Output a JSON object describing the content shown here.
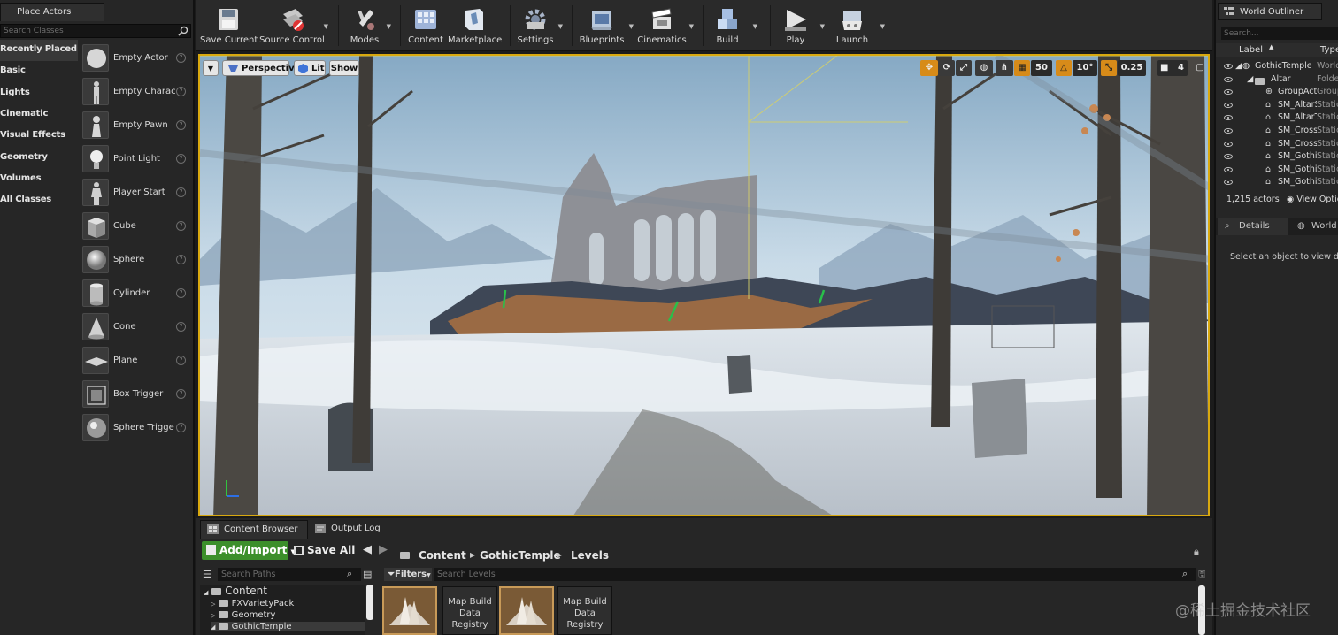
{
  "left_panel": {
    "tab": "Place Actors",
    "search_placeholder": "Search Classes",
    "categories": [
      "Recently Placed",
      "Basic",
      "Lights",
      "Cinematic",
      "Visual Effects",
      "Geometry",
      "Volumes",
      "All Classes"
    ],
    "actors": [
      "Empty Actor",
      "Empty Charac",
      "Empty Pawn",
      "Point Light",
      "Player Start",
      "Cube",
      "Sphere",
      "Cylinder",
      "Cone",
      "Plane",
      "Box Trigger",
      "Sphere Trigge"
    ],
    "help_glyph": "?"
  },
  "toolbar": {
    "save_current": "Save Current",
    "source_control": "Source Control",
    "modes": "Modes",
    "content": "Content",
    "marketplace": "Marketplace",
    "settings": "Settings",
    "blueprints": "Blueprints",
    "cinematics": "Cinematics",
    "build": "Build",
    "play": "Play",
    "launch": "Launch"
  },
  "viewport": {
    "perspective": "Perspective",
    "lit": "Lit",
    "show": "Show",
    "grid_snap": "50",
    "rotation_snap": "10°",
    "scale_snap": "0.25",
    "camera_speed": "4"
  },
  "outliner": {
    "tab": "World Outliner",
    "search_placeholder": "Search...",
    "col_label": "Label",
    "col_type": "Type",
    "rows": [
      {
        "label": "GothicTemple",
        "type": "World"
      },
      {
        "label": "Altar",
        "type": "Folde"
      },
      {
        "label": "GroupActo",
        "type": "Group"
      },
      {
        "label": "SM_AltarS",
        "type": "Static"
      },
      {
        "label": "SM_AltarT",
        "type": "Static"
      },
      {
        "label": "SM_Cross",
        "type": "Static"
      },
      {
        "label": "SM_Cross",
        "type": "Static"
      },
      {
        "label": "SM_Gothi",
        "type": "Static"
      },
      {
        "label": "SM_Gothi",
        "type": "Static"
      },
      {
        "label": "SM_Gothi",
        "type": "Static"
      }
    ],
    "actor_count": "1,215 actors",
    "view_options": "View Optic"
  },
  "details": {
    "tab_details": "Details",
    "tab_world": "World S",
    "empty_msg": "Select an object to view deta"
  },
  "bottom": {
    "tab_content_browser": "Content Browser",
    "tab_output_log": "Output Log",
    "add_import": "Add/Import",
    "save_all": "Save All",
    "breadcrumb": [
      "Content",
      "GothicTemple",
      "Levels"
    ],
    "search_paths_placeholder": "Search Paths",
    "filters": "Filters",
    "search_levels_placeholder": "Search Levels",
    "tree_root": "Content",
    "tree_items": [
      "FXVarietyPack",
      "Geometry",
      "GothicTemple"
    ],
    "assets": [
      "Map Build Data Registry",
      "Map Build Data Registry"
    ]
  },
  "watermark": "@稀土掘金技术社区",
  "colors": {
    "accent": "#d9a90f",
    "add_button": "#3c8f2b",
    "snap_active": "#e0a020"
  }
}
